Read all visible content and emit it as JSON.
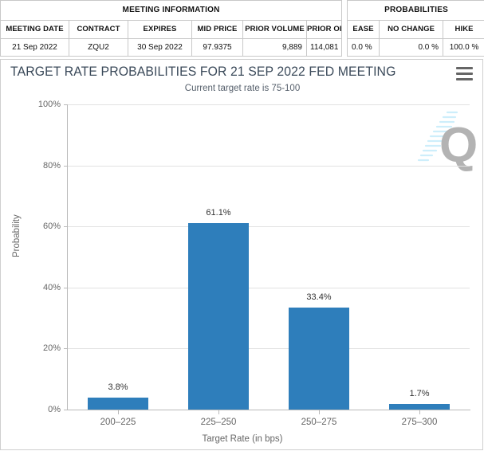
{
  "tables": {
    "meeting_information": {
      "group_header": "MEETING INFORMATION",
      "columns": [
        "MEETING DATE",
        "CONTRACT",
        "EXPIRES",
        "MID PRICE",
        "PRIOR VOLUME",
        "PRIOR OI"
      ],
      "rows": [
        {
          "meeting_date": "21 Sep 2022",
          "contract": "ZQU2",
          "expires": "30 Sep 2022",
          "mid_price": "97.9375",
          "prior_volume": "9,889",
          "prior_oi": "114,081"
        }
      ]
    },
    "probabilities": {
      "group_header": "PROBABILITIES",
      "columns": [
        "EASE",
        "NO CHANGE",
        "HIKE"
      ],
      "rows": [
        {
          "ease": "0.0 %",
          "no_change": "0.0 %",
          "hike": "100.0 %"
        }
      ]
    }
  },
  "chart_panel": {
    "title": "TARGET RATE PROBABILITIES FOR 21 SEP 2022 FED MEETING",
    "subtitle": "Current target rate is 75-100",
    "menu_icon": "hamburger-menu-icon",
    "watermark_letter": "Q"
  },
  "chart_data": {
    "type": "bar",
    "title": "TARGET RATE PROBABILITIES FOR 21 SEP 2022 FED MEETING",
    "subtitle": "Current target rate is 75-100",
    "categories": [
      "200–225",
      "225–250",
      "250–275",
      "275–300"
    ],
    "values": [
      3.8,
      61.1,
      33.4,
      1.7
    ],
    "data_labels": [
      "3.8%",
      "61.1%",
      "33.4%",
      "1.7%"
    ],
    "xlabel": "Target Rate (in bps)",
    "ylabel": "Probability",
    "ylim": [
      0,
      100
    ],
    "ytick_labels": [
      "0%",
      "20%",
      "40%",
      "60%",
      "80%",
      "100%"
    ],
    "ytick_values": [
      0,
      20,
      40,
      60,
      80,
      100
    ],
    "grid": true,
    "legend": "none",
    "bar_color": "#2e7ebb",
    "axis_color": "#b9b9b9",
    "grid_color": "#e2e2e2"
  }
}
